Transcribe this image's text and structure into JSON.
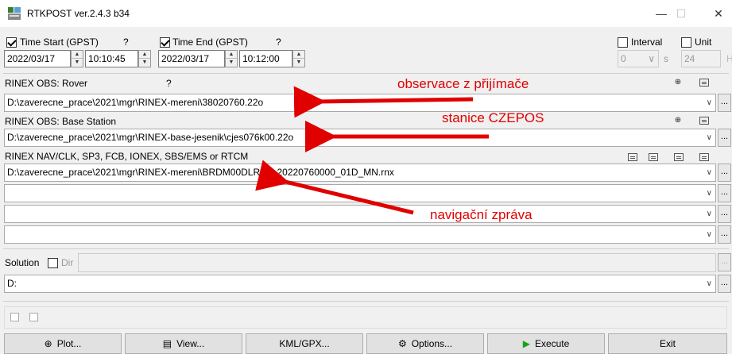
{
  "window": {
    "title": "RTKPOST ver.2.4.3 b34",
    "minimize": "—",
    "maximize": "☐",
    "close": "✕"
  },
  "time": {
    "start_label": "Time Start (GPST)",
    "start_help": "?",
    "start_date": "2022/03/17",
    "start_time": "10:10:45",
    "end_label": "Time End (GPST)",
    "end_help": "?",
    "end_date": "2022/03/17",
    "end_time": "10:12:00",
    "interval_label": "Interval",
    "interval_value": "0",
    "interval_unit": "s",
    "unit_label": "Unit",
    "unit_value": "24",
    "unit_suffix": "H"
  },
  "rover": {
    "label": "RINEX OBS: Rover",
    "help": "?",
    "path": "D:\\zaverecne_prace\\2021\\mgr\\RINEX-mereni\\38020760.22o"
  },
  "base": {
    "label": "RINEX OBS: Base Station",
    "path": "D:\\zaverecne_prace\\2021\\mgr\\RINEX-base-jesenik\\cjes076k00.22o"
  },
  "nav": {
    "label": "RINEX NAV/CLK, SP3, FCB, IONEX, SBS/EMS  or RTCM",
    "path1": "D:\\zaverecne_prace\\2021\\mgr\\RINEX-mereni\\BRDM00DLR_S_20220760000_01D_MN.rnx",
    "path2": "",
    "path3": "",
    "path4": ""
  },
  "solution": {
    "label": "Solution",
    "dir_label": "Dir",
    "dir_path": "",
    "path": "D:"
  },
  "annotations": {
    "rover": "observace z přijímače",
    "base": "stanice CZEPOS",
    "nav": "navigační zpráva"
  },
  "dropdown_glyph": "∨",
  "browse_glyph": "...",
  "buttons": {
    "plot": "Plot...",
    "view": "View...",
    "kml": "KML/GPX...",
    "options": "Options...",
    "execute": "Execute",
    "exit": "Exit"
  },
  "colors": {
    "annotation": "#e00000",
    "execute": "#1aa31a"
  }
}
